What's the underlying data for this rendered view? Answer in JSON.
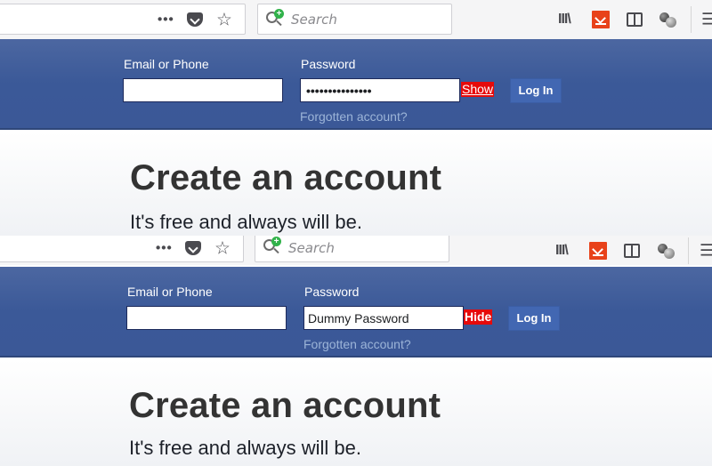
{
  "colors": {
    "header_bg": "#3b5998",
    "toggle_bg": "#e60a0a",
    "login_bg": "#4267b2",
    "forgot_link": "#9cb4d8"
  },
  "panels": [
    {
      "state": "password-hidden",
      "browser": {
        "page_actions_icon": "three-dots-icon",
        "pocket_icon": "pocket-icon",
        "bookmark_icon": "star-icon",
        "search_placeholder": "Search",
        "toolbar_icons": [
          "library-icon",
          "aliexpress-icon",
          "sidebar-icon",
          "extension-icon",
          "menu-icon"
        ],
        "menu_glyph": "☰",
        "library_glyph": "III\\"
      },
      "login": {
        "email_label": "Email or Phone",
        "email_value": "",
        "password_label": "Password",
        "password_value": "•••••••••••••••",
        "toggle_label": "Show",
        "login_button": "Log In",
        "forgot_link": "Forgotten account?"
      },
      "main": {
        "headline": "Create an account",
        "tagline": "It's free and always will be."
      }
    },
    {
      "state": "password-revealed",
      "browser": {
        "page_actions_icon": "three-dots-icon",
        "pocket_icon": "pocket-icon",
        "bookmark_icon": "star-icon",
        "search_placeholder": "Search",
        "toolbar_icons": [
          "library-icon",
          "aliexpress-icon",
          "sidebar-icon",
          "extension-icon",
          "menu-icon"
        ],
        "menu_glyph": "☰",
        "library_glyph": "III\\"
      },
      "login": {
        "email_label": "Email or Phone",
        "email_value": "",
        "password_label": "Password",
        "password_value": "Dummy Password",
        "toggle_label": "Hide",
        "login_button": "Log In",
        "forgot_link": "Forgotten account?"
      },
      "main": {
        "headline": "Create an account",
        "tagline": "It's free and always will be."
      }
    }
  ]
}
